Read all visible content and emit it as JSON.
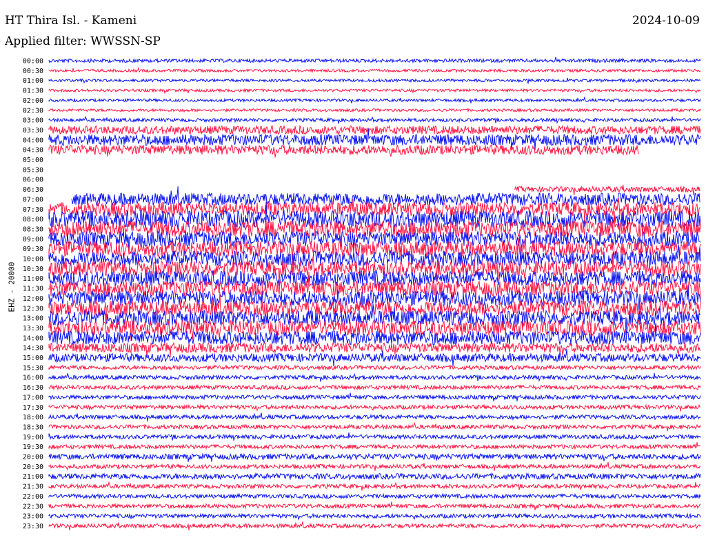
{
  "header": {
    "station": "HT Thira Isl. - Kameni",
    "date": "2024-10-09",
    "filter": "Applied filter: WWSSN-SP"
  },
  "channel_label": "EHZ - 20000",
  "colors": {
    "blue": "#0a14f0",
    "red": "#ff1744",
    "background": "#ffffff"
  },
  "chart_data": {
    "type": "line",
    "subtype": "helicorder",
    "rows": [
      {
        "time": "00:00",
        "color": "blue",
        "amplitude": 2.5
      },
      {
        "time": "00:30",
        "color": "red",
        "amplitude": 2
      },
      {
        "time": "01:00",
        "color": "blue",
        "amplitude": 2
      },
      {
        "time": "01:30",
        "color": "red",
        "amplitude": 2
      },
      {
        "time": "02:00",
        "color": "blue",
        "amplitude": 2
      },
      {
        "time": "02:30",
        "color": "red",
        "amplitude": 2
      },
      {
        "time": "03:00",
        "color": "blue",
        "amplitude": 2.5
      },
      {
        "time": "03:30",
        "color": "red",
        "amplitude": 6
      },
      {
        "time": "04:00",
        "color": "blue",
        "amplitude": 8
      },
      {
        "time": "04:30",
        "color": "red",
        "amplitude": 7,
        "end": 0.905
      },
      {
        "time": "05:00",
        "color": "blue",
        "amplitude": 0,
        "end": 0
      },
      {
        "time": "05:30",
        "color": "red",
        "amplitude": 0,
        "end": 0
      },
      {
        "time": "06:00",
        "color": "blue",
        "amplitude": 0,
        "end": 0
      },
      {
        "time": "06:30",
        "color": "red",
        "amplitude": 4,
        "start": 0.715
      },
      {
        "time": "07:00",
        "color": "blue",
        "amplitude": 9,
        "start": 0.035
      },
      {
        "time": "07:30",
        "color": "red",
        "amplitude": 10
      },
      {
        "time": "08:00",
        "color": "blue",
        "amplitude": 12
      },
      {
        "time": "08:30",
        "color": "red",
        "amplitude": 12
      },
      {
        "time": "09:00",
        "color": "blue",
        "amplitude": 11
      },
      {
        "time": "09:30",
        "color": "red",
        "amplitude": 11
      },
      {
        "time": "10:00",
        "color": "blue",
        "amplitude": 11
      },
      {
        "time": "10:30",
        "color": "red",
        "amplitude": 11
      },
      {
        "time": "11:00",
        "color": "blue",
        "amplitude": 11
      },
      {
        "time": "11:30",
        "color": "red",
        "amplitude": 11
      },
      {
        "time": "12:00",
        "color": "blue",
        "amplitude": 11
      },
      {
        "time": "12:30",
        "color": "red",
        "amplitude": 11
      },
      {
        "time": "13:00",
        "color": "blue",
        "amplitude": 11
      },
      {
        "time": "13:30",
        "color": "red",
        "amplitude": 11
      },
      {
        "time": "14:00",
        "color": "blue",
        "amplitude": 10
      },
      {
        "time": "14:30",
        "color": "red",
        "amplitude": 7
      },
      {
        "time": "15:00",
        "color": "blue",
        "amplitude": 6
      },
      {
        "time": "15:30",
        "color": "red",
        "amplitude": 3
      },
      {
        "time": "16:00",
        "color": "blue",
        "amplitude": 3
      },
      {
        "time": "16:30",
        "color": "red",
        "amplitude": 3
      },
      {
        "time": "17:00",
        "color": "blue",
        "amplitude": 3
      },
      {
        "time": "17:30",
        "color": "red",
        "amplitude": 3
      },
      {
        "time": "18:00",
        "color": "blue",
        "amplitude": 3
      },
      {
        "time": "18:30",
        "color": "red",
        "amplitude": 3
      },
      {
        "time": "19:00",
        "color": "blue",
        "amplitude": 3
      },
      {
        "time": "19:30",
        "color": "red",
        "amplitude": 3
      },
      {
        "time": "20:00",
        "color": "blue",
        "amplitude": 4
      },
      {
        "time": "20:30",
        "color": "red",
        "amplitude": 3
      },
      {
        "time": "21:00",
        "color": "blue",
        "amplitude": 4
      },
      {
        "time": "21:30",
        "color": "red",
        "amplitude": 3
      },
      {
        "time": "22:00",
        "color": "blue",
        "amplitude": 3
      },
      {
        "time": "22:30",
        "color": "red",
        "amplitude": 3
      },
      {
        "time": "23:00",
        "color": "blue",
        "amplitude": 3
      },
      {
        "time": "23:30",
        "color": "red",
        "amplitude": 3
      }
    ],
    "grid": false,
    "legend": "none"
  }
}
